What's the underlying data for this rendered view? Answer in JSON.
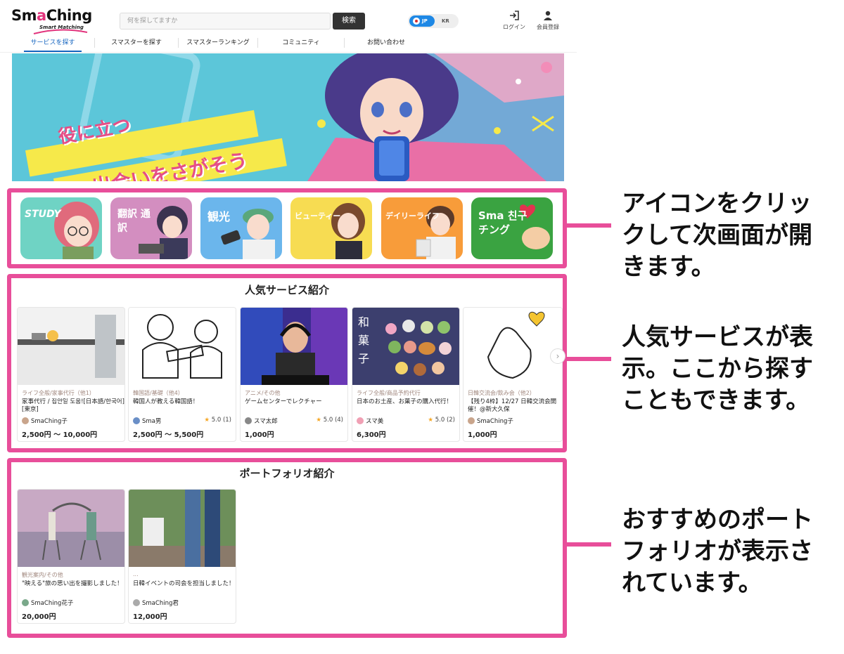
{
  "header": {
    "logo_main_1": "Sm",
    "logo_a": "a",
    "logo_main_2": "Ching",
    "logo_sub": "Smart Matching",
    "search_placeholder": "何を探してますか",
    "search_button": "検索",
    "lang_jp": "JP",
    "lang_kr": "KR",
    "login_label": "ログイン",
    "signup_label": "会員登録"
  },
  "nav": {
    "items": [
      "サービスを探す",
      "スマスターを探す",
      "スマスターランキング",
      "コミュニティ",
      "お問い合わせ"
    ]
  },
  "hero": {
    "line1": "役に立つ",
    "line2": "出会いをさがそう"
  },
  "categories": {
    "items": [
      "STUDY",
      "翻訳 通訳",
      "観光",
      "ビューティー",
      "デイリーライフ",
      "Sma 친구 チング"
    ]
  },
  "popular": {
    "title": "人気サービス紹介",
    "cards": [
      {
        "category": "ライフ全般/家事代行（他1）",
        "title": "家事代行 / 집안일 도움![日本語/한국어][東京]",
        "seller": "SmaChing子",
        "rating": "",
        "price": "2,500円 ～ 10,000円"
      },
      {
        "category": "韓国語/基礎（他4）",
        "title": "韓国人が教える韓国語！",
        "seller": "Sma男",
        "rating": "5.0 (1)",
        "price": "2,500円 ～ 5,500円"
      },
      {
        "category": "アニメ/その他",
        "title": "ゲームセンターでレクチャー",
        "seller": "スマ太郎",
        "rating": "5.0 (4)",
        "price": "1,000円"
      },
      {
        "category": "ライフ全般/商品予約代行",
        "title": "日本のお土産、お菓子の購入代行！",
        "seller": "スマ美",
        "rating": "5.0 (2)",
        "price": "6,300円"
      },
      {
        "category": "日韓交流会/飲み会（他2）",
        "title": "【残り4枠】12/27 日韓交流会開催！@新大久保",
        "seller": "SmaChing子",
        "rating": "",
        "price": "1,000円"
      }
    ]
  },
  "portfolio": {
    "title": "ポートフォリオ紹介",
    "cards": [
      {
        "category": "観光案内/その他",
        "title": "\"映える\"旅の思い出を撮影しました！",
        "seller": "SmaChing花子",
        "price": "20,000円"
      },
      {
        "category": "...",
        "title": "日韓イベントの司会を担当しました！",
        "seller": "SmaChing君",
        "price": "12,000円"
      }
    ]
  },
  "callouts": {
    "c1": [
      "アイコンをクリッ",
      "クして次画面が開",
      "きます。"
    ],
    "c2": [
      "人気サービスが表",
      "示。ここから探す",
      "こともできます。"
    ],
    "c3": [
      "おすすめのポート",
      "フォリオが表示さ",
      "れています。"
    ]
  },
  "colors": {
    "annotation": "#e84e9a",
    "nav_active": "#1565c0",
    "lang_active": "#1e88e5",
    "star": "#f5a623"
  }
}
